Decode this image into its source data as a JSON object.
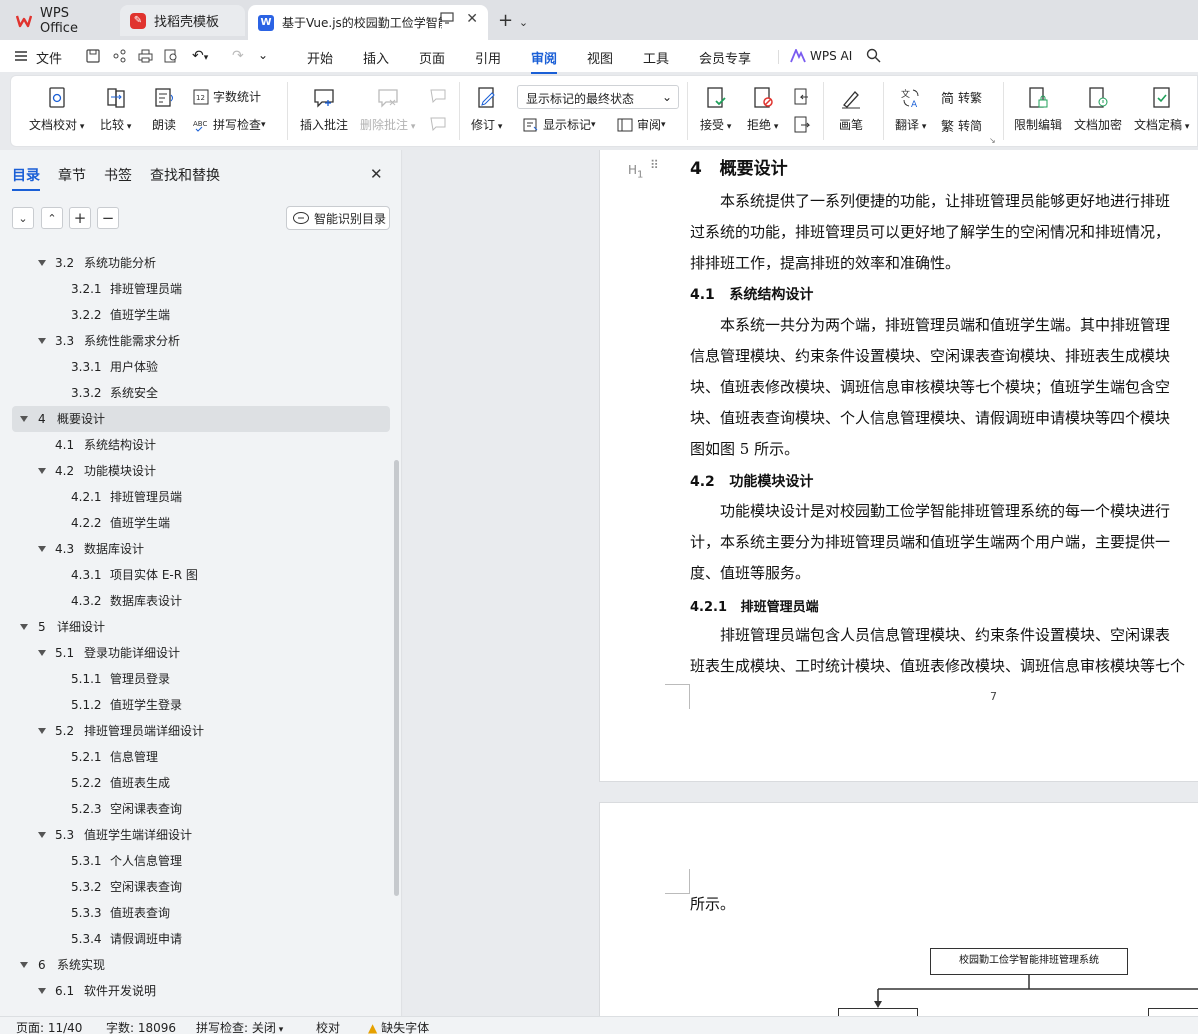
{
  "tabs": [
    {
      "label": "WPS Office",
      "icon": "wps-logo-icon"
    },
    {
      "label": "找稻壳模板",
      "icon": "daoke-logo-icon"
    },
    {
      "label": "基于Vue.js的校园勤工俭学智能",
      "icon": "word-doc-icon"
    }
  ],
  "menu": {
    "file": "文件",
    "items": [
      "开始",
      "插入",
      "页面",
      "引用",
      "审阅",
      "视图",
      "工具",
      "会员专享"
    ],
    "active": "审阅",
    "ai": "WPS AI"
  },
  "ribbon": {
    "doc_check": "文档校对",
    "compare": "比较",
    "read_aloud": "朗读",
    "word_count": "字数统计",
    "spell_check": "拼写检查",
    "insert_comment": "插入批注",
    "delete_comment": "删除批注",
    "track_changes": "修订",
    "markup_combo": "显示标记的最终状态",
    "show_markup": "显示标记",
    "review": "审阅",
    "accept": "接受",
    "reject": "拒绝",
    "pen": "画笔",
    "translate": "翻译",
    "to_traditional": "转繁",
    "to_simplified": "转简",
    "restrict_edit": "限制编辑",
    "encrypt": "文档加密",
    "finalize": "文档定稿"
  },
  "nav": {
    "tabs": [
      "目录",
      "章节",
      "书签",
      "查找和替换"
    ],
    "active_tab": "目录",
    "smart_toc": "智能识别目录",
    "toc": [
      {
        "num": "3.2",
        "text": "系统功能分析",
        "level": 2,
        "expanded": true
      },
      {
        "num": "3.2.1",
        "text": "排班管理员端",
        "level": 3
      },
      {
        "num": "3.2.2",
        "text": "值班学生端",
        "level": 3
      },
      {
        "num": "3.3",
        "text": "系统性能需求分析",
        "level": 2,
        "expanded": true
      },
      {
        "num": "3.3.1",
        "text": "用户体验",
        "level": 3
      },
      {
        "num": "3.3.2",
        "text": "系统安全",
        "level": 3
      },
      {
        "num": "4",
        "text": "概要设计",
        "level": 1,
        "expanded": true,
        "selected": true
      },
      {
        "num": "4.1",
        "text": "系统结构设计",
        "level": 2
      },
      {
        "num": "4.2",
        "text": "功能模块设计",
        "level": 2,
        "expanded": true
      },
      {
        "num": "4.2.1",
        "text": "排班管理员端",
        "level": 3
      },
      {
        "num": "4.2.2",
        "text": "值班学生端",
        "level": 3
      },
      {
        "num": "4.3",
        "text": "数据库设计",
        "level": 2,
        "expanded": true
      },
      {
        "num": "4.3.1",
        "text": "项目实体 E-R 图",
        "level": 3
      },
      {
        "num": "4.3.2",
        "text": "数据库表设计",
        "level": 3
      },
      {
        "num": "5",
        "text": "详细设计",
        "level": 1,
        "expanded": true
      },
      {
        "num": "5.1",
        "text": "登录功能详细设计",
        "level": 2,
        "expanded": true
      },
      {
        "num": "5.1.1",
        "text": "管理员登录",
        "level": 3
      },
      {
        "num": "5.1.2",
        "text": "值班学生登录",
        "level": 3
      },
      {
        "num": "5.2",
        "text": "排班管理员端详细设计",
        "level": 2,
        "expanded": true
      },
      {
        "num": "5.2.1",
        "text": "信息管理",
        "level": 3
      },
      {
        "num": "5.2.2",
        "text": "值班表生成",
        "level": 3
      },
      {
        "num": "5.2.3",
        "text": "空闲课表查询",
        "level": 3
      },
      {
        "num": "5.3",
        "text": "值班学生端详细设计",
        "level": 2,
        "expanded": true
      },
      {
        "num": "5.3.1",
        "text": "个人信息管理",
        "level": 3
      },
      {
        "num": "5.3.2",
        "text": "空闲课表查询",
        "level": 3
      },
      {
        "num": "5.3.3",
        "text": "值班表查询",
        "level": 3
      },
      {
        "num": "5.3.4",
        "text": "请假调班申请",
        "level": 3
      },
      {
        "num": "6",
        "text": "系统实现",
        "level": 1,
        "expanded": true
      },
      {
        "num": "6.1",
        "text": "软件开发说明",
        "level": 2,
        "expanded": true
      }
    ]
  },
  "document": {
    "h1": "4   概要设计",
    "p1": [
      "本系统提供了一系列便捷的功能，让排班管理员能够更好地进行排班",
      "过系统的功能，排班管理员可以更好地了解学生的空闲情况和排班情况，",
      "排排班工作，提高排班的效率和准确性。"
    ],
    "h41": "4.1   系统结构设计",
    "p2": [
      "本系统一共分为两个端，排班管理员端和值班学生端。其中排班管理",
      "信息管理模块、约束条件设置模块、空闲课表查询模块、排班表生成模块",
      "块、值班表修改模块、调班信息审核模块等七个模块；值班学生端包含空",
      "块、值班表查询模块、个人信息管理模块、请假调班申请模块等四个模块",
      "图如图 5 所示。"
    ],
    "h42": "4.2   功能模块设计",
    "p3": [
      "功能模块设计是对校园勤工俭学智能排班管理系统的每一个模块进行",
      "计，本系统主要分为排班管理员端和值班学生端两个用户端，主要提供一",
      "度、值班等服务。"
    ],
    "h421": "4.2.1   排班管理员端",
    "p4": [
      "排班管理员端包含人员信息管理模块、约束条件设置模块、空闲课表",
      "班表生成模块、工时统计模块、值班表修改模块、调班信息审核模块等七个"
    ],
    "page_number": "7",
    "page2_text": "所示。",
    "diagram_root": "校园勤工俭学智能排班管理系统"
  },
  "status": {
    "page": "页面: 11/40",
    "words": "字数: 18096",
    "spell": "拼写检查: 关闭",
    "proof": "校对",
    "missing_font": "缺失字体"
  },
  "colors": {
    "accent": "#1a5fd6",
    "wps_red": "#e0332e"
  }
}
